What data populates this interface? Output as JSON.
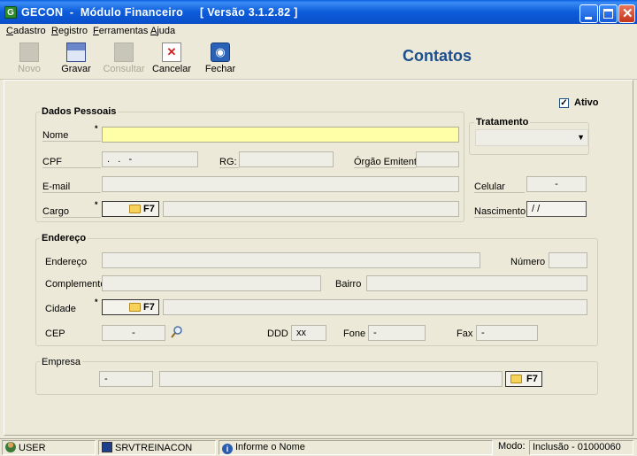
{
  "window": {
    "title": "GECON  -  Módulo Financeiro     [ Versão 3.1.2.82 ]",
    "app_icon_letter": "G"
  },
  "menu": [
    "Cadastro",
    "Registro",
    "Ferramentas",
    "Ajuda"
  ],
  "toolbar": {
    "novo": "Novo",
    "gravar": "Gravar",
    "consultar": "Consultar",
    "cancelar": "Cancelar",
    "fechar": "Fechar"
  },
  "page_title": "Contatos",
  "ativo": {
    "label": "Ativo",
    "checked": true,
    "mark": "✓"
  },
  "dados_pessoais": {
    "title": "Dados Pessoais",
    "nome_label": "Nome",
    "nome_value": "",
    "cpf_label": "CPF",
    "cpf_value": ".   .   -",
    "rg_label": "RG:",
    "rg_value": "",
    "orgao_label": "Órgão Emitente",
    "orgao_value": "",
    "email_label": "E-mail",
    "email_value": "",
    "celular_label": "Celular",
    "celular_value": "-",
    "cargo_label": "Cargo",
    "cargo_button": "F7",
    "cargo_value": "",
    "nascimento_label": "Nascimento",
    "nascimento_value": "/ /"
  },
  "tratamento": {
    "title": "Tratamento",
    "value": "",
    "arrow": "▼"
  },
  "endereco": {
    "title": "Endereço",
    "endereco_label": "Endereço",
    "endereco_value": "",
    "numero_label": "Número",
    "numero_value": "",
    "complemento_label": "Complemento",
    "complemento_value": "",
    "bairro_label": "Bairro",
    "bairro_value": "",
    "cidade_label": "Cidade",
    "cidade_button": "F7",
    "cidade_value": "",
    "cep_label": "CEP",
    "cep_value": "-",
    "ddd_label": "DDD",
    "ddd_value": "xx",
    "fone_label": "Fone",
    "fone_value": "-",
    "fax_label": "Fax",
    "fax_value": "-"
  },
  "empresa": {
    "title": "Empresa",
    "code_value": "-",
    "name_value": "",
    "button": "F7"
  },
  "statusbar": {
    "user": "USER",
    "server": "SRVTREINACON",
    "hint": "Informe o Nome",
    "mode_label": "Modo:",
    "mode_value": "Inclusão - 01000060"
  },
  "colors": {
    "title_blue": "#1a4e8e",
    "required_field": "#ffffa8",
    "window_bg": "#ece9d8"
  }
}
